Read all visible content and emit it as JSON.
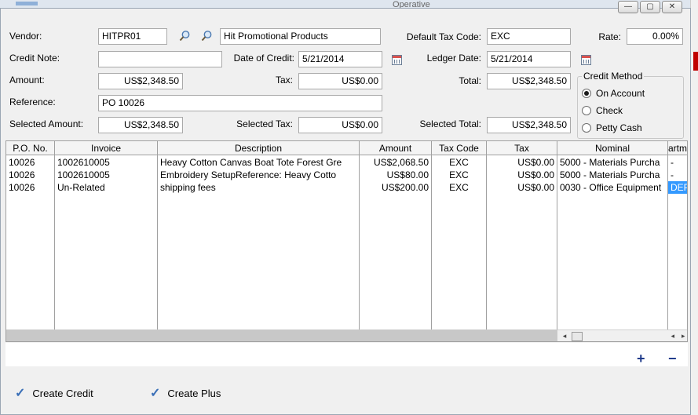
{
  "background": {
    "title_hint": "Operative"
  },
  "window": {
    "minimize": "—",
    "maximize": "▢",
    "close": "✕"
  },
  "form": {
    "vendor_label": "Vendor:",
    "vendor_code": "HITPR01",
    "vendor_name": "Hit Promotional Products",
    "default_tax_code_label": "Default Tax Code:",
    "default_tax_code": "EXC",
    "rate_label": "Rate:",
    "rate": "0.00%",
    "credit_note_label": "Credit Note:",
    "credit_note": "",
    "date_of_credit_label": "Date of Credit:",
    "date_of_credit": "5/21/2014",
    "ledger_date_label": "Ledger Date:",
    "ledger_date": "5/21/2014",
    "amount_label": "Amount:",
    "amount": "US$2,348.50",
    "tax_label": "Tax:",
    "tax": "US$0.00",
    "total_label": "Total:",
    "total": "US$2,348.50",
    "reference_label": "Reference:",
    "reference": "PO 10026",
    "selected_amount_label": "Selected Amount:",
    "selected_amount": "US$2,348.50",
    "selected_tax_label": "Selected Tax:",
    "selected_tax": "US$0.00",
    "selected_total_label": "Selected Total:",
    "selected_total": "US$2,348.50"
  },
  "credit_method": {
    "title": "Credit Method",
    "options": [
      "On Account",
      "Check",
      "Petty Cash"
    ],
    "selected": "On Account"
  },
  "grid": {
    "columns": [
      "P.O. No.",
      "Invoice",
      "Description",
      "Amount",
      "Tax Code",
      "Tax",
      "Nominal",
      "artm"
    ],
    "rows": [
      [
        "10026",
        "1002610005",
        "Heavy Cotton Canvas Boat Tote Forest Gre",
        "US$2,068.50",
        "EXC",
        "US$0.00",
        "5000 - Materials Purcha",
        "-"
      ],
      [
        "10026",
        "1002610005",
        "Embroidery SetupReference: Heavy Cotto",
        "US$80.00",
        "EXC",
        "US$0.00",
        "5000 - Materials Purcha",
        "-"
      ],
      [
        "10026",
        "Un-Related",
        "shipping fees",
        "US$200.00",
        "EXC",
        "US$0.00",
        "0030 - Office Equipment",
        "DEP"
      ]
    ],
    "scroll_left": "◂",
    "scroll_right": "▸"
  },
  "actions": {
    "add": "+",
    "remove": "−",
    "create_credit": "Create Credit",
    "create_plus": "Create Plus"
  }
}
